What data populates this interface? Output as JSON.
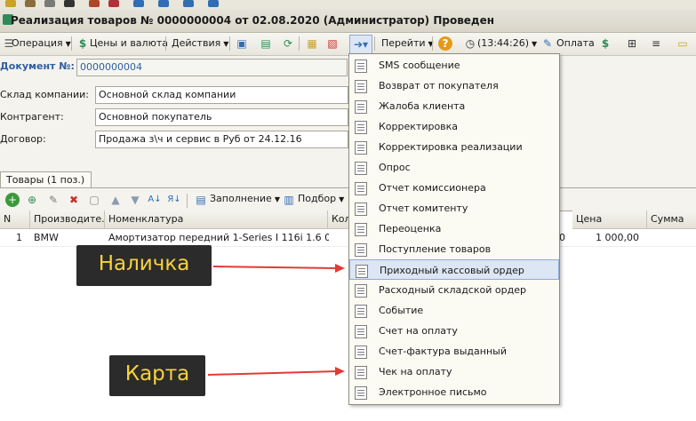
{
  "window": {
    "title": "Реализация товаров № 0000000004 от 02.08.2020 (Администратор) Проведен"
  },
  "toolbar": {
    "operation": "Операция",
    "prices": "Цены и валюта",
    "actions": "Действия",
    "goto": "Перейти",
    "time": "(13:44:26)",
    "payment": "Оплата"
  },
  "document": {
    "number_label": "Документ №:",
    "number_value": "0000000004",
    "warehouse_label": "Склад компании:",
    "warehouse_value": "Основной склад компании",
    "counterparty_label": "Контрагент:",
    "counterparty_value": "Основной покупатель",
    "contract_label": "Договор:",
    "contract_value": "Продажа з\\ч и сервис в Руб от 24.12.16"
  },
  "tabs": {
    "goods": "Товары (1 поз.)"
  },
  "grid_toolbar": {
    "fill": "Заполнение",
    "select": "Подбор"
  },
  "grid": {
    "headers": [
      "N",
      "Производите...",
      "Номенклатура",
      "Кол",
      "Цена",
      "Сумма"
    ],
    "row": {
      "n": "1",
      "maker": "BMW",
      "item": "Амортизатор передний 1-Series I 116i 1.6 07>1...",
      "qty_tail": "00",
      "price": "1 000,00",
      "sum": ""
    }
  },
  "menu": {
    "items": [
      "SMS сообщение",
      "Возврат от покупателя",
      "Жалоба клиента",
      "Корректировка",
      "Корректировка реализации",
      "Опрос",
      "Отчет комиссионера",
      "Отчет комитенту",
      "Переоценка",
      "Поступление товаров",
      "Приходный кассовый ордер",
      "Расходный складской ордер",
      "Событие",
      "Счет на оплату",
      "Счет-фактура выданный",
      "Чек на оплату",
      "Электронное письмо"
    ],
    "highlighted_index": 10
  },
  "annotations": {
    "cash": "Наличка",
    "card": "Карта",
    "color": "#e53935"
  }
}
